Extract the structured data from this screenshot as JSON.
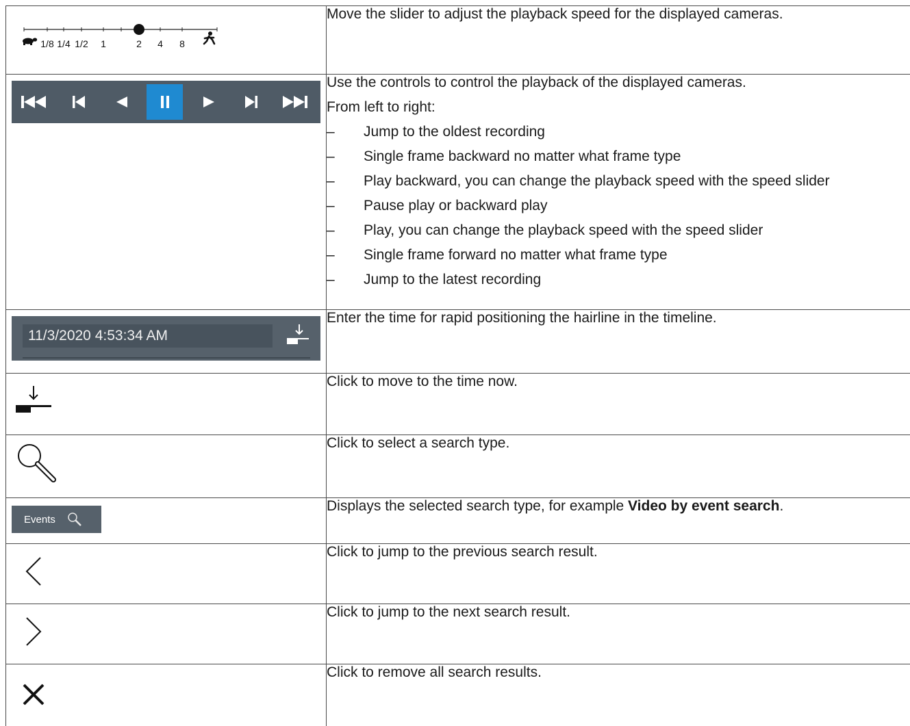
{
  "rows": [
    {
      "icon": "speed-slider",
      "slider": {
        "labels": [
          "1/8",
          "1/4",
          "1/2",
          "1",
          "2",
          "4",
          "8"
        ],
        "current": "2",
        "left_icon": "turtle-icon",
        "right_icon": "running-person-icon"
      },
      "text": "Move the slider to adjust the playback speed for the displayed cameras."
    },
    {
      "icon": "playback-controls",
      "buttons": [
        {
          "name": "jump-oldest-icon",
          "active": false
        },
        {
          "name": "frame-backward-icon",
          "active": false
        },
        {
          "name": "play-backward-icon",
          "active": false
        },
        {
          "name": "pause-icon",
          "active": true
        },
        {
          "name": "play-icon",
          "active": false
        },
        {
          "name": "frame-forward-icon",
          "active": false
        },
        {
          "name": "jump-latest-icon",
          "active": false
        }
      ],
      "intro1": "Use the controls to control the playback of the displayed cameras.",
      "intro2": "From left to right:",
      "dash": "–",
      "items": [
        "Jump to the oldest recording",
        "Single frame backward no matter what frame type",
        "Play backward, you can change the playback speed with the speed slider",
        "Pause play or backward play",
        "Play, you can change the playback speed with the speed slider",
        "Single frame forward no matter what frame type",
        "Jump to the latest recording"
      ]
    },
    {
      "icon": "time-field",
      "time_value": "11/3/2020 4:53:34 AM",
      "text": "Enter the time for rapid positioning the hairline in the timeline."
    },
    {
      "icon": "jump-to-now-icon",
      "text": "Click to move to the time now."
    },
    {
      "icon": "search-icon",
      "text": "Click to select a search type."
    },
    {
      "icon": "events-button",
      "button_label": "Events",
      "text_before": "Displays the selected search type, for example ",
      "text_bold": "Video by event search",
      "text_after": "."
    },
    {
      "icon": "chevron-left-icon",
      "text": "Click to jump to the previous search result."
    },
    {
      "icon": "chevron-right-icon",
      "text": "Click to jump to the next search result."
    },
    {
      "icon": "close-icon",
      "text": "Click to remove all search results."
    }
  ],
  "colors": {
    "toolbar_bg": "#4f5b66",
    "active_button": "#1f8ad1",
    "border": "#4a4a4a"
  }
}
